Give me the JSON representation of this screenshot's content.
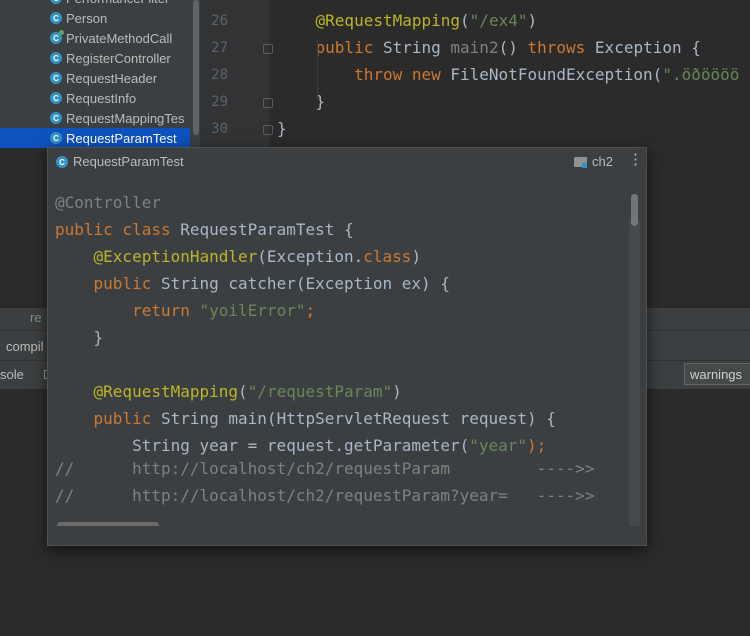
{
  "project_tree": {
    "items": [
      {
        "label": "PerformanceFilter",
        "run": false,
        "selected": false
      },
      {
        "label": "Person",
        "run": false,
        "selected": false
      },
      {
        "label": "PrivateMethodCall",
        "run": true,
        "selected": false
      },
      {
        "label": "RegisterController",
        "run": false,
        "selected": false
      },
      {
        "label": "RequestHeader",
        "run": false,
        "selected": false
      },
      {
        "label": "RequestInfo",
        "run": false,
        "selected": false
      },
      {
        "label": "RequestMappingTes",
        "run": false,
        "selected": false
      },
      {
        "label": "RequestParamTest",
        "run": false,
        "selected": true
      }
    ],
    "class_icon_letter": "C"
  },
  "editor": {
    "line_numbers": [
      "26",
      "27",
      "28",
      "29",
      "30"
    ],
    "lines": [
      {
        "parts": [
          {
            "t": "    "
          },
          {
            "t": "@RequestMapping",
            "c": "ann"
          },
          {
            "t": "("
          },
          {
            "t": "\"/ex4\"",
            "c": "str"
          },
          {
            "t": ")"
          }
        ]
      },
      {
        "parts": [
          {
            "t": "    "
          },
          {
            "t": "public ",
            "c": "kw"
          },
          {
            "t": "String "
          },
          {
            "t": "main2",
            "c": "cm"
          },
          {
            "t": "() "
          },
          {
            "t": "throws ",
            "c": "kw"
          },
          {
            "t": "Exception {"
          }
        ]
      },
      {
        "parts": [
          {
            "t": "        "
          },
          {
            "t": "throw new ",
            "c": "kw"
          },
          {
            "t": "FileNotFoundException("
          },
          {
            "t": "\".öðöööö",
            "c": "str"
          }
        ]
      },
      {
        "parts": [
          {
            "t": "    }"
          }
        ]
      },
      {
        "parts": [
          {
            "t": "}"
          }
        ]
      }
    ]
  },
  "lower": {
    "tab_text": "re",
    "build_tab": "compil",
    "console_label": "sole",
    "warnings_button": "warnings"
  },
  "popup": {
    "title": "RequestParamTest",
    "module": "ch2",
    "menu_glyph": "⋮",
    "lines": [
      {
        "parts": [
          {
            "t": "@Controller",
            "c": "cm"
          }
        ]
      },
      {
        "parts": [
          {
            "t": "public class ",
            "c": "kw"
          },
          {
            "t": "RequestParamTest {"
          }
        ]
      },
      {
        "parts": [
          {
            "t": "    "
          },
          {
            "t": "@ExceptionHandler",
            "c": "ann"
          },
          {
            "t": "(Exception."
          },
          {
            "t": "class",
            "c": "kw"
          },
          {
            "t": ")"
          }
        ]
      },
      {
        "parts": [
          {
            "t": "    "
          },
          {
            "t": "public ",
            "c": "kw"
          },
          {
            "t": "String catcher(Exception ex) {"
          }
        ]
      },
      {
        "parts": [
          {
            "t": "        "
          },
          {
            "t": "return ",
            "c": "kw"
          },
          {
            "t": "\"yoilError\"",
            "c": "str"
          },
          {
            "t": ";",
            "c": "kw"
          }
        ]
      },
      {
        "parts": [
          {
            "t": "    }"
          }
        ]
      },
      {
        "parts": [
          {
            "t": ""
          }
        ]
      },
      {
        "parts": [
          {
            "t": "    "
          },
          {
            "t": "@RequestMapping",
            "c": "ann"
          },
          {
            "t": "("
          },
          {
            "t": "\"/requestParam\"",
            "c": "str"
          },
          {
            "t": ")"
          }
        ]
      },
      {
        "parts": [
          {
            "t": "    "
          },
          {
            "t": "public ",
            "c": "kw"
          },
          {
            "t": "String main(HttpServletRequest request) {"
          }
        ]
      },
      {
        "parts": [
          {
            "t": "        String year = request.getParameter("
          },
          {
            "t": "\"year\"",
            "c": "str"
          },
          {
            "t": ");",
            "c": "kw"
          }
        ]
      },
      {
        "parts": [
          {
            "t": "//      http://localhost/ch2/requestParam         ---->>",
            "c": "cm"
          }
        ]
      },
      {
        "parts": [
          {
            "t": "//      http://localhost/ch2/requestParam?year=   ---->>",
            "c": "cm"
          }
        ]
      }
    ]
  },
  "colors": {
    "keyword": "#cc7832",
    "annotation": "#bbb529",
    "string": "#6a8759",
    "comment": "#808080",
    "selection": "#0d52bf",
    "class_icon": "#3592c4"
  }
}
